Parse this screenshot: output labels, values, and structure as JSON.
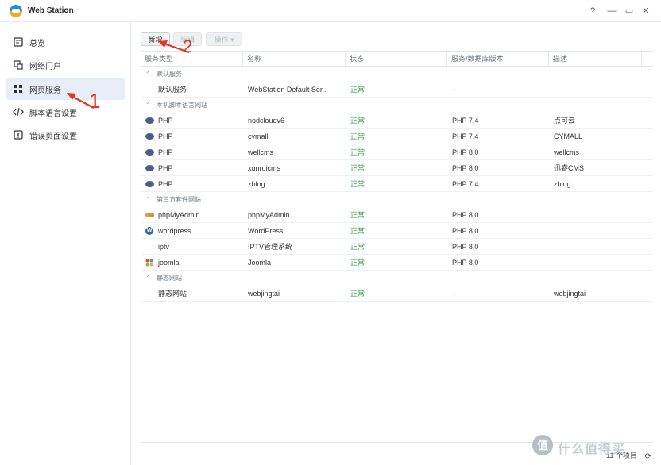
{
  "window": {
    "title": "Web Station",
    "controls": [
      "?",
      "—",
      "▭",
      "✕"
    ]
  },
  "sidebar": {
    "items": [
      {
        "label": "总览",
        "icon": "overview-icon"
      },
      {
        "label": "网络门户",
        "icon": "portal-icon"
      },
      {
        "label": "网页服务",
        "icon": "grid-icon",
        "active": true
      },
      {
        "label": "脚本语言设置",
        "icon": "code-icon"
      },
      {
        "label": "错误页面设置",
        "icon": "error-icon"
      }
    ]
  },
  "toolbar": {
    "new_label": "新增",
    "edit_label": "编辑",
    "actions_label": "操作 ▾"
  },
  "table": {
    "columns": [
      "服务类型",
      "名称",
      "状态",
      "服务/数据库版本",
      "描述"
    ],
    "groups": [
      {
        "label": "默认服务",
        "rows": [
          {
            "type": "默认服务",
            "icon": "",
            "name": "WebStation Default Ser...",
            "status": "正常",
            "version": "--",
            "desc": ""
          }
        ]
      },
      {
        "label": "本机脚本语言网站",
        "rows": [
          {
            "type": "PHP",
            "icon": "php",
            "name": "nodcloudv6",
            "status": "正常",
            "version": "PHP 7.4",
            "desc": "点可云"
          },
          {
            "type": "PHP",
            "icon": "php",
            "name": "cymall",
            "status": "正常",
            "version": "PHP 7.4",
            "desc": "CYMALL"
          },
          {
            "type": "PHP",
            "icon": "php",
            "name": "wellcms",
            "status": "正常",
            "version": "PHP 8.0",
            "desc": "wellcms"
          },
          {
            "type": "PHP",
            "icon": "php",
            "name": "xunruicms",
            "status": "正常",
            "version": "PHP 8.0",
            "desc": "迅睿CMS"
          },
          {
            "type": "PHP",
            "icon": "php",
            "name": "zblog",
            "status": "正常",
            "version": "PHP 7.4",
            "desc": "zblog"
          }
        ]
      },
      {
        "label": "第三方套件网站",
        "rows": [
          {
            "type": "phpMyAdmin",
            "icon": "pma",
            "name": "phpMyAdmin",
            "status": "正常",
            "version": "PHP 8.0",
            "desc": ""
          },
          {
            "type": "wordpress",
            "icon": "wp",
            "name": "WordPress",
            "status": "正常",
            "version": "PHP 8.0",
            "desc": ""
          },
          {
            "type": "iptv",
            "icon": "",
            "name": "IPTV管理系统",
            "status": "正常",
            "version": "PHP 8.0",
            "desc": ""
          },
          {
            "type": "joomla",
            "icon": "joomla",
            "name": "Joomla",
            "status": "正常",
            "version": "PHP 8.0",
            "desc": ""
          }
        ]
      },
      {
        "label": "静态网站",
        "rows": [
          {
            "type": "静态网站",
            "icon": "",
            "name": "webjingtai",
            "status": "正常",
            "version": "--",
            "desc": "webjingtai"
          }
        ]
      }
    ]
  },
  "footer": {
    "count_label": "11 个项目"
  },
  "annotations": {
    "label1": "1",
    "label2": "2",
    "arrow_color": "#e8341c"
  },
  "watermark": {
    "circle": "值",
    "text": "什么值得买"
  }
}
